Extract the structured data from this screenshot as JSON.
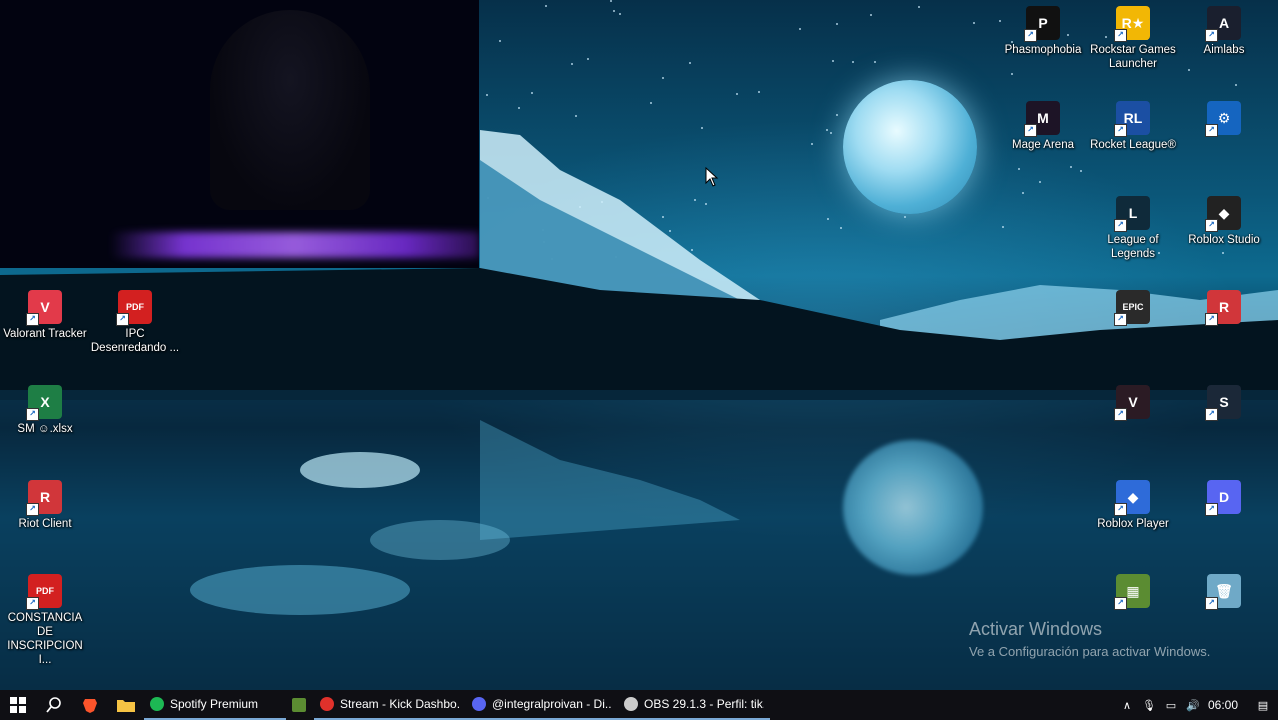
{
  "desktop": {
    "left_icons": [
      {
        "label": "Valorant Tracker",
        "color": "#e23a4a",
        "glyph": "V"
      },
      {
        "label": "IPC Desenredando ...",
        "color": "#d32020",
        "glyph": "PDF"
      },
      {
        "label": "SM ☺.xlsx",
        "color": "#1e7e45",
        "glyph": "X"
      },
      {
        "label": "Riot Client",
        "color": "#d1363a",
        "glyph": "R"
      },
      {
        "label": "CONSTANCIA DE INSCRIPCION I...",
        "color": "#d32020",
        "glyph": "PDF"
      }
    ],
    "right_icons": [
      {
        "label": "Phasmophobia",
        "color": "#111111",
        "glyph": "P"
      },
      {
        "label": "Rockstar Games Launcher",
        "color": "#f2b705",
        "glyph": "R★"
      },
      {
        "label": "Aimlabs",
        "color": "#1a1f2e",
        "glyph": "A"
      },
      {
        "label": "Mage Arena",
        "color": "#1d1426",
        "glyph": "M"
      },
      {
        "label": "Rocket League®",
        "color": "#1b4fa3",
        "glyph": "RL"
      },
      {
        "label": "",
        "color": "#1565c0",
        "glyph": "⚙"
      },
      {
        "label": "League of Legends",
        "color": "#0f2a3a",
        "glyph": "L"
      },
      {
        "label": "Roblox Studio",
        "color": "#222222",
        "glyph": "◆"
      },
      {
        "label": "",
        "color": "#2a2a2a",
        "glyph": "EPIC"
      },
      {
        "label": "",
        "color": "#d1363a",
        "glyph": "R"
      },
      {
        "label": "",
        "color": "#2b1b24",
        "glyph": "V"
      },
      {
        "label": "",
        "color": "#1b2838",
        "glyph": "S"
      },
      {
        "label": "Roblox Player",
        "color": "#2e6bd9",
        "glyph": "◆"
      },
      {
        "label": "",
        "color": "#5865f2",
        "glyph": "D"
      },
      {
        "label": "",
        "color": "#5b8c32",
        "glyph": "▦"
      },
      {
        "label": "",
        "color": "#6fa9c7",
        "glyph": "🗑"
      }
    ],
    "watermark": {
      "title": "Activar Windows",
      "subtitle": "Ve a Configuración para activar Windows."
    }
  },
  "taskbar": {
    "apps": [
      {
        "label": "Spotify Premium",
        "color": "#1db954"
      },
      {
        "label": "",
        "color": "#5b8c32"
      },
      {
        "label": "Stream - Kick Dashbo...",
        "color": "#e0312b"
      },
      {
        "label": "@integralproivan - Di...",
        "color": "#5865f2"
      },
      {
        "label": "OBS 29.1.3 - Perfil: tik...",
        "color": "#cccccc"
      }
    ],
    "clock": "06:00"
  }
}
